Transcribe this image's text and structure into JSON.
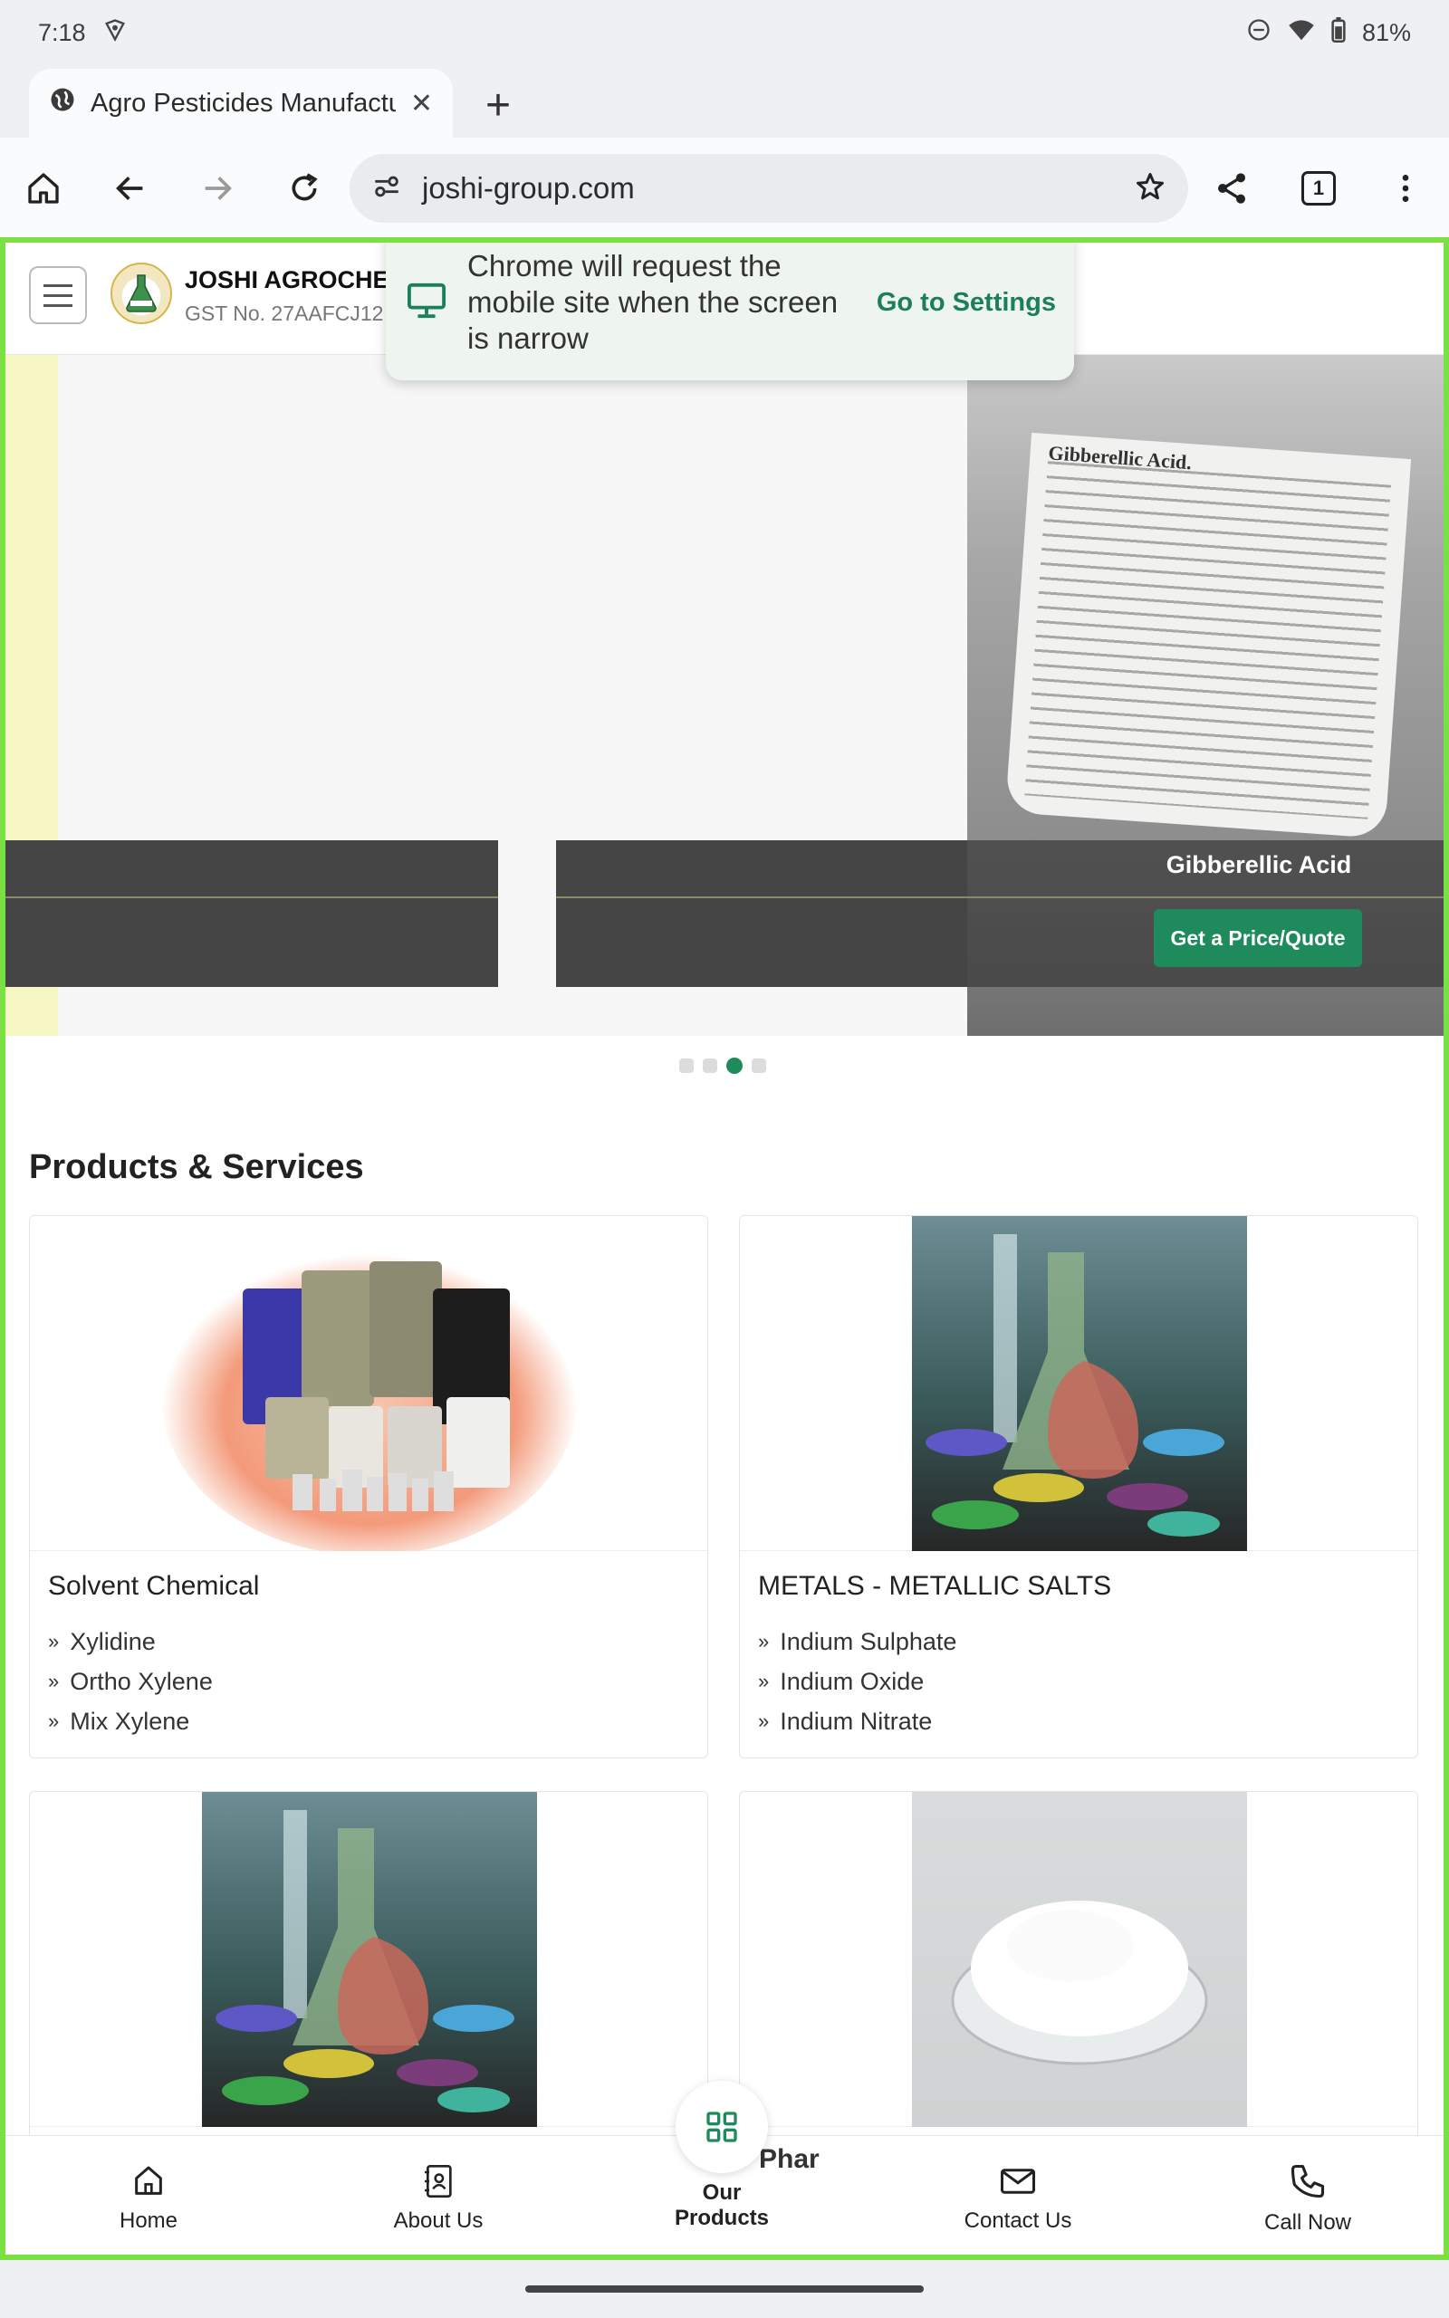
{
  "status": {
    "time": "7:18",
    "battery": "81%"
  },
  "tab": {
    "title": "Agro Pesticides Manufactur",
    "close": "✕",
    "new_tab": "+"
  },
  "toolbar": {
    "url": "joshi-group.com",
    "tab_count": "1"
  },
  "popup": {
    "message": "Chrome will request the mobile site when the screen is narrow",
    "action": "Go to Settings"
  },
  "site": {
    "brand_name": "JOSHI AGROCHE",
    "gst": "GST No. 27AAFCJ12"
  },
  "carousel": {
    "caption": "Gibberellic Acid",
    "cta": "Get a Price/Quote",
    "label_heading": "Gibberellic Acid.",
    "slide_count": 4,
    "active_slide": 3
  },
  "section": {
    "title": "Products & Services"
  },
  "cards": [
    {
      "title": "Solvent Chemical",
      "items": [
        "Xylidine",
        "Ortho Xylene",
        "Mix Xylene"
      ]
    },
    {
      "title": "METALS - METALLIC SALTS",
      "items": [
        "Indium Sulphate",
        "Indium Oxide",
        "Indium Nitrate"
      ]
    }
  ],
  "peek": {
    "text": "Phar"
  },
  "bottom_nav": {
    "home": "Home",
    "about": "About Us",
    "products_line1": "Our",
    "products_line2": "Products",
    "contact": "Contact Us",
    "call": "Call Now"
  },
  "colors": {
    "accent": "#1f8a5c",
    "focus_border": "#7be042"
  }
}
